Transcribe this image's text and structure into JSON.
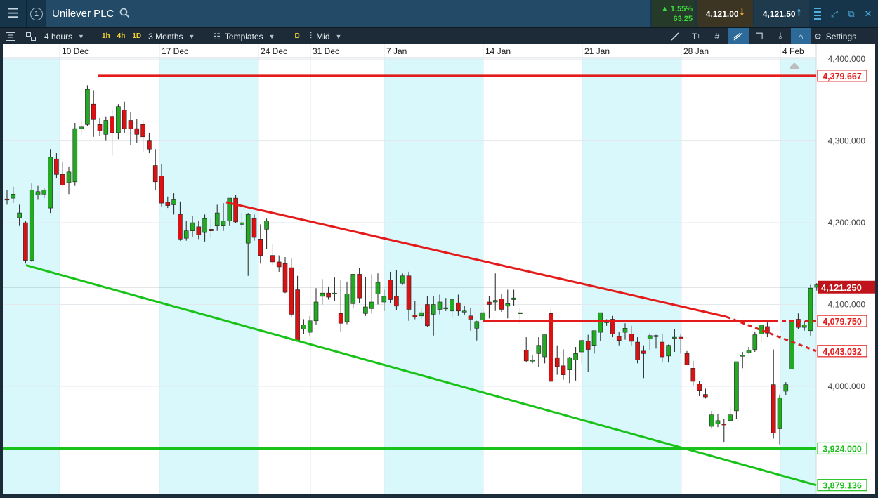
{
  "header": {
    "instrument": "Unilever PLC",
    "change_pct": "▲ 1.55%",
    "change_abs": "63.25",
    "sell_price": "4,121.00",
    "buy_price": "4,121.50",
    "panel_number": "1"
  },
  "toolbar": {
    "interval": "4 hours",
    "quick_1h": "1h",
    "quick_4h": "4h",
    "quick_1d": "1D",
    "range": "3 Months",
    "templates": "Templates",
    "d_label": "D",
    "price_mode": "Mid",
    "settings": "Settings"
  },
  "icons": {
    "menu": "menu-icon",
    "search": "search-icon",
    "sell_arrow": "arrow-down-icon",
    "buy_arrow": "arrow-up-icon",
    "expand": "expand-icon",
    "popout": "popout-icon",
    "close": "close-icon"
  },
  "colors": {
    "up": "#22aa22",
    "down": "#dd1111",
    "resistance": "#e31b1b",
    "support": "#19c219",
    "weekend_shade": "#d8f8fc",
    "last_price": "#c0141b"
  },
  "chart_data": {
    "type": "candlestick",
    "instrument": "Unilever PLC",
    "interval": "4 hours",
    "range": "3 Months",
    "x_ticks": [
      "10 Dec",
      "17 Dec",
      "24 Dec",
      "31 Dec",
      "7 Jan",
      "14 Jan",
      "21 Jan",
      "28 Jan",
      "4 Feb"
    ],
    "y_ticks": [
      4000,
      4100,
      4200,
      4300,
      4400
    ],
    "y_tick_labels": [
      "4,000.000",
      "4,100.000",
      "4,200.000",
      "4,300.000",
      "4,400.000"
    ],
    "ylim": [
      3872,
      4407
    ],
    "last_price": {
      "value": 4121.25,
      "label": "4,121.250"
    },
    "levels": [
      {
        "label": "4,379.667",
        "value": 4379.667,
        "color": "#e31b1b",
        "kind": "horizontal"
      },
      {
        "label": "4,079.750",
        "value": 4079.75,
        "color": "#e31b1b",
        "kind": "horizontal"
      },
      {
        "label": "4,043.032",
        "value": 4043.032,
        "color": "#e31b1b",
        "kind": "trendline"
      },
      {
        "label": "3,924.000",
        "value": 3924,
        "color": "#19c219",
        "kind": "horizontal"
      },
      {
        "label": "3,879.136",
        "value": 3879.136,
        "color": "#19c219",
        "kind": "trendline"
      }
    ],
    "candles": [
      [
        4229,
        4240,
        4222,
        4228
      ],
      [
        4230,
        4244,
        4224,
        4235
      ],
      [
        4206,
        4222,
        4196,
        4212
      ],
      [
        4200,
        4202,
        4150,
        4154
      ],
      [
        4154,
        4248,
        4152,
        4240
      ],
      [
        4234,
        4245,
        4228,
        4238
      ],
      [
        4235,
        4242,
        4230,
        4240
      ],
      [
        4218,
        4290,
        4212,
        4280
      ],
      [
        4278,
        4285,
        4255,
        4259
      ],
      [
        4259,
        4275,
        4245,
        4246
      ],
      [
        4249,
        4268,
        4235,
        4262
      ],
      [
        4250,
        4322,
        4245,
        4315
      ],
      [
        4315,
        4325,
        4308,
        4317
      ],
      [
        4320,
        4368,
        4318,
        4363
      ],
      [
        4345,
        4362,
        4305,
        4326
      ],
      [
        4320,
        4328,
        4306,
        4312
      ],
      [
        4308,
        4330,
        4300,
        4325
      ],
      [
        4330,
        4338,
        4282,
        4310
      ],
      [
        4310,
        4345,
        4302,
        4342
      ],
      [
        4338,
        4348,
        4310,
        4315
      ],
      [
        4325,
        4335,
        4295,
        4315
      ],
      [
        4315,
        4327,
        4298,
        4308
      ],
      [
        4320,
        4325,
        4286,
        4305
      ],
      [
        4300,
        4310,
        4285,
        4290
      ],
      [
        4270,
        4290,
        4240,
        4250
      ],
      [
        4257,
        4272,
        4220,
        4224
      ],
      [
        4225,
        4232,
        4218,
        4221
      ],
      [
        4222,
        4236,
        4210,
        4228
      ],
      [
        4210,
        4226,
        4178,
        4180
      ],
      [
        4181,
        4202,
        4178,
        4190
      ],
      [
        4190,
        4208,
        4182,
        4200
      ],
      [
        4195,
        4202,
        4180,
        4185
      ],
      [
        4188,
        4210,
        4177,
        4205
      ],
      [
        4192,
        4205,
        4181,
        4190
      ],
      [
        4196,
        4222,
        4190,
        4212
      ],
      [
        4196,
        4224,
        4190,
        4202
      ],
      [
        4202,
        4226,
        4196,
        4230
      ],
      [
        4230,
        4234,
        4200,
        4201
      ],
      [
        4198,
        4212,
        4192,
        4200
      ],
      [
        4175,
        4212,
        4135,
        4210
      ],
      [
        4205,
        4210,
        4178,
        4182
      ],
      [
        4180,
        4198,
        4150,
        4160
      ],
      [
        4192,
        4205,
        4168,
        4202
      ],
      [
        4160,
        4174,
        4148,
        4152
      ],
      [
        4152,
        4160,
        4140,
        4146
      ],
      [
        4150,
        4158,
        4114,
        4115
      ],
      [
        4145,
        4156,
        4085,
        4088
      ],
      [
        4118,
        4135,
        4055,
        4056
      ],
      [
        4070,
        4082,
        4064,
        4075
      ],
      [
        4066,
        4086,
        4062,
        4080
      ],
      [
        4080,
        4120,
        4075,
        4103
      ],
      [
        4110,
        4131,
        4100,
        4114
      ],
      [
        4114,
        4122,
        4106,
        4109
      ],
      [
        4113,
        4133,
        4104,
        4114
      ],
      [
        4089,
        4130,
        4067,
        4077
      ],
      [
        4079,
        4128,
        4076,
        4113
      ],
      [
        4101,
        4128,
        4095,
        4137
      ],
      [
        4137,
        4145,
        4102,
        4108
      ],
      [
        4089,
        4134,
        4086,
        4097
      ],
      [
        4095,
        4137,
        4089,
        4103
      ],
      [
        4113,
        4138,
        4100,
        4127
      ],
      [
        4103,
        4118,
        4092,
        4110
      ],
      [
        4130,
        4140,
        4102,
        4106
      ],
      [
        4110,
        4142,
        4093,
        4098
      ],
      [
        4126,
        4138,
        4124,
        4135
      ],
      [
        4135,
        4140,
        4080,
        4094
      ],
      [
        4087,
        4104,
        4082,
        4085
      ],
      [
        4086,
        4096,
        4082,
        4090
      ],
      [
        4100,
        4110,
        4073,
        4074
      ],
      [
        4088,
        4110,
        4062,
        4100
      ],
      [
        4094,
        4112,
        4088,
        4103
      ],
      [
        4095,
        4108,
        4092,
        4096
      ],
      [
        4092,
        4106,
        4084,
        4106
      ],
      [
        4102,
        4112,
        4086,
        4092
      ],
      [
        4092,
        4098,
        4087,
        4092
      ],
      [
        4086,
        4096,
        4068,
        4082
      ],
      [
        4071,
        4080,
        4056,
        4079
      ],
      [
        4081,
        4096,
        4078,
        4090
      ],
      [
        4103,
        4110,
        4083,
        4100
      ],
      [
        4103,
        4138,
        4092,
        4105
      ],
      [
        4107,
        4113,
        4091,
        4094
      ],
      [
        4098,
        4118,
        4083,
        4101
      ],
      [
        4106,
        4118,
        4098,
        4108
      ],
      [
        4090,
        4096,
        4077,
        4090
      ],
      [
        4044,
        4060,
        4030,
        4031
      ],
      [
        4031,
        4038,
        4028,
        4032
      ],
      [
        4040,
        4060,
        4024,
        4050
      ],
      [
        4036,
        4052,
        4028,
        4063
      ],
      [
        4089,
        4095,
        4005,
        4006
      ],
      [
        4035,
        4050,
        4014,
        4024
      ],
      [
        4025,
        4045,
        4008,
        4014
      ],
      [
        4020,
        4036,
        4004,
        4035
      ],
      [
        4032,
        4048,
        4007,
        4040
      ],
      [
        4042,
        4058,
        4027,
        4056
      ],
      [
        4055,
        4063,
        4018,
        4045
      ],
      [
        4050,
        4066,
        4040,
        4068
      ],
      [
        4066,
        4090,
        4055,
        4090
      ],
      [
        4079,
        4082,
        4074,
        4079
      ],
      [
        4082,
        4086,
        4060,
        4064
      ],
      [
        4061,
        4066,
        4050,
        4056
      ],
      [
        4066,
        4077,
        4057,
        4071
      ],
      [
        4064,
        4074,
        4050,
        4055
      ],
      [
        4054,
        4060,
        4028,
        4032
      ],
      [
        4043,
        4050,
        4010,
        4040
      ],
      [
        4058,
        4065,
        4044,
        4062
      ],
      [
        4061,
        4063,
        4046,
        4062
      ],
      [
        4054,
        4064,
        4030,
        4036
      ],
      [
        4037,
        4051,
        4029,
        4050
      ],
      [
        4060,
        4070,
        4042,
        4060
      ],
      [
        4060,
        4064,
        4040,
        4058
      ],
      [
        4040,
        4043,
        4027,
        4026
      ],
      [
        4022,
        4031,
        4001,
        4006
      ],
      [
        4003,
        4006,
        3988,
        3995
      ],
      [
        3990,
        3997,
        3985,
        3987
      ],
      [
        3951,
        3970,
        3948,
        3965
      ],
      [
        3954,
        3966,
        3950,
        3958
      ],
      [
        3954,
        3960,
        3932,
        3953
      ],
      [
        3958,
        3975,
        3958,
        3965
      ],
      [
        3970,
        4030,
        3960,
        4030
      ],
      [
        4038,
        4042,
        4022,
        4038
      ],
      [
        4041,
        4048,
        4040,
        4044
      ],
      [
        4045,
        4067,
        4042,
        4063
      ],
      [
        4064,
        4075,
        4054,
        4075
      ],
      [
        4073,
        4078,
        4060,
        4065
      ],
      [
        4002,
        4045,
        3936,
        3943
      ],
      [
        3948,
        3990,
        3929,
        3986
      ],
      [
        3994,
        4005,
        3989,
        4002
      ],
      [
        4021,
        4080,
        4020,
        4080
      ],
      [
        4082,
        4089,
        4070,
        4072
      ],
      [
        4072,
        4080,
        4068,
        4075
      ],
      [
        4068,
        4124,
        4062,
        4120
      ],
      [
        4121,
        4126,
        4117,
        4124
      ]
    ]
  }
}
